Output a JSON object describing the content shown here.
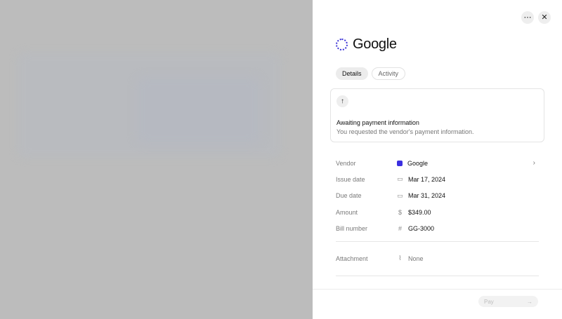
{
  "panel": {
    "title": "Google",
    "tabs": [
      {
        "label": "Details",
        "active": true
      },
      {
        "label": "Activity",
        "active": false
      }
    ],
    "status": {
      "title": "Awaiting payment information",
      "subtitle": "You requested the vendor's payment information."
    },
    "fields": [
      {
        "label": "Vendor",
        "value": "Google",
        "icon": "square-dot"
      },
      {
        "label": "Issue date",
        "value": "Mar 17, 2024",
        "icon": "calendar-icon"
      },
      {
        "label": "Due date",
        "value": "Mar 31, 2024",
        "icon": "calendar-icon"
      },
      {
        "label": "Amount",
        "value": "$349.00",
        "icon": "dollar-icon"
      },
      {
        "label": "Bill number",
        "value": "GG-3000",
        "icon": "hash-icon"
      }
    ],
    "attachment": {
      "label": "Attachment",
      "value": "None"
    },
    "pay_label": "Pay"
  },
  "colors": {
    "accent": "#3b2fe0",
    "overlay": "#bcbcbc"
  }
}
